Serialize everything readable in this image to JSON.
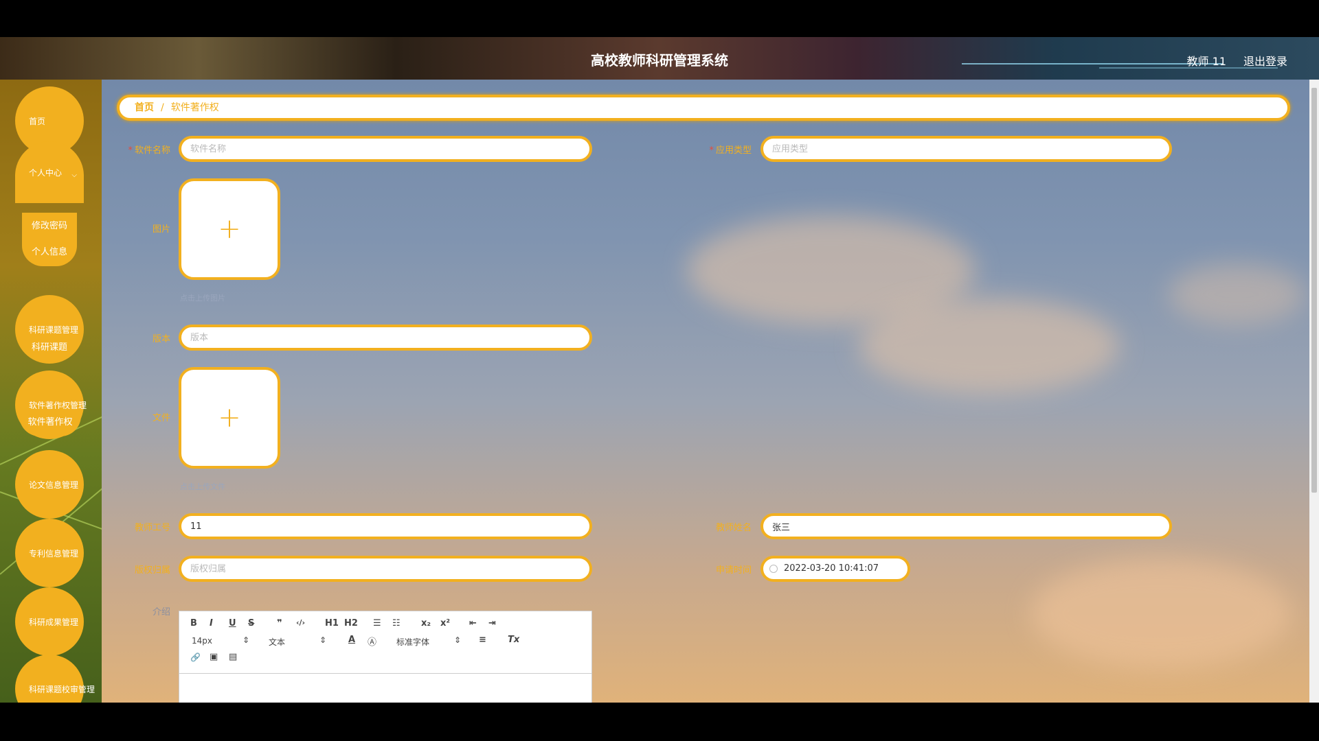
{
  "header": {
    "title": "高校教师科研管理系统",
    "user": "教师 11",
    "logout": "退出登录"
  },
  "sidebar": {
    "items": [
      {
        "label": "首页"
      },
      {
        "label": "个人中心",
        "children": [
          "修改密码",
          "个人信息"
        ]
      },
      {
        "label": "科研课题管理",
        "children": [
          "科研课题"
        ]
      },
      {
        "label": "软件著作权管理",
        "children": [
          "软件著作权"
        ]
      },
      {
        "label": "论文信息管理"
      },
      {
        "label": "专利信息管理"
      },
      {
        "label": "科研成果管理"
      },
      {
        "label": "科研课题校审管理"
      }
    ]
  },
  "breadcrumb": {
    "home": "首页",
    "separator": "/",
    "current": "软件著作权"
  },
  "form": {
    "software_name": {
      "label": "软件名称",
      "placeholder": "软件名称",
      "value": ""
    },
    "app_type": {
      "label": "应用类型",
      "placeholder": "应用类型",
      "value": ""
    },
    "image": {
      "label": "图片",
      "hint": "点击上传图片",
      "plus": "+"
    },
    "version": {
      "label": "版本",
      "placeholder": "版本",
      "value": ""
    },
    "file": {
      "label": "文件",
      "hint": "点击上传文件",
      "plus": "+"
    },
    "teacher_id": {
      "label": "教师工号",
      "value": "11"
    },
    "teacher_name": {
      "label": "教师姓名",
      "value": "张三"
    },
    "copyright_owner": {
      "label": "版权归属",
      "placeholder": "版权归属",
      "value": ""
    },
    "apply_time": {
      "label": "申请时间",
      "value": "2022-03-20 10:41:07"
    },
    "intro": {
      "label": "介绍"
    }
  },
  "editor": {
    "buttons_row1": [
      "B",
      "I",
      "U",
      "S",
      "❞",
      "‹/›",
      "H1",
      "H2",
      "☰",
      "☷",
      "x₂",
      "x²",
      "⇤",
      "⇥"
    ],
    "font_size": "14px",
    "text_type": "文本",
    "font_family": "标准字体",
    "row2_icons": [
      "A",
      "Ⓐ",
      "≡",
      "Tx"
    ],
    "row3_icons": [
      "🔗",
      "▣",
      "▤"
    ]
  },
  "colors": {
    "accent": "#f2b01f",
    "required": "#e64a3a"
  }
}
